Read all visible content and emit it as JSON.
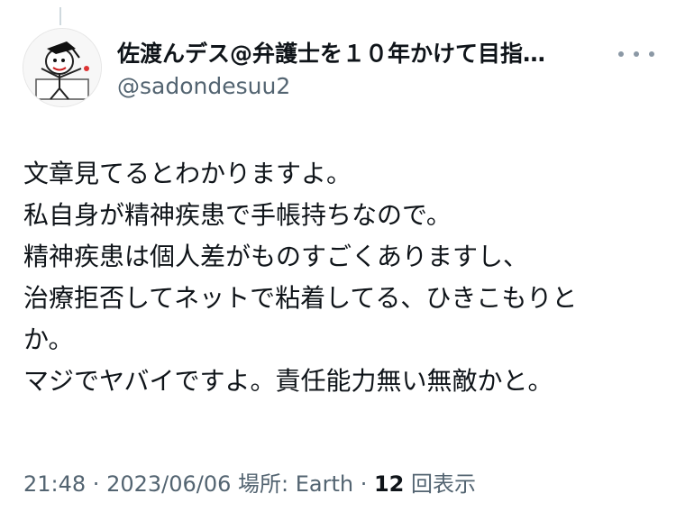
{
  "tweet": {
    "display_name": "佐渡んデス@弁護士を１０年かけて目指…",
    "handle": "@sadondesuu2",
    "lines": [
      "文章見てるとわかりますよ。",
      "私自身が精神疾患で手帳持ちなので。",
      "精神疾患は個人差がものすごくありますし、",
      "治療拒否してネットで粘着してる、ひきこもりと",
      "か。",
      "マジでヤバイですよ。責任能力無い無敵かと。"
    ],
    "time": "21:48",
    "sep1": " · ",
    "date": "2023/06/06",
    "location": " 場所: Earth",
    "sep2": " · ",
    "view_count": "12",
    "view_label": " 回表示"
  },
  "icons": {
    "avatar": "cartoon-character-avatar",
    "more": "more-dots-icon"
  }
}
